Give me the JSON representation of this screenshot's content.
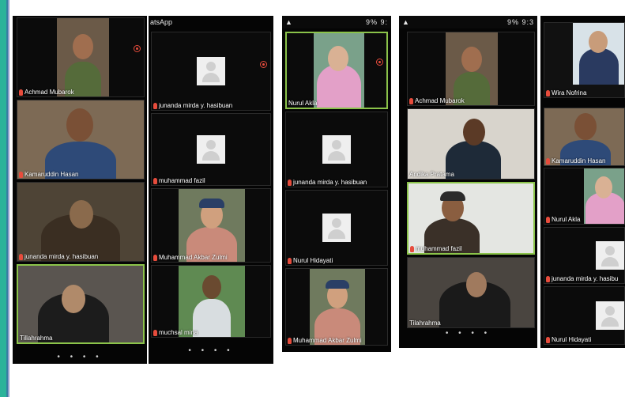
{
  "phone1": {
    "tiles": [
      {
        "name": "Achmad Mubarok"
      },
      {
        "name": "Kamaruddin Hasan"
      },
      {
        "name": "junanda mirda y. hasibuan"
      },
      {
        "name": "Tillahrahma"
      }
    ]
  },
  "phone2": {
    "app_title": "atsApp",
    "tiles": [
      {
        "name": "junanda mirda y. hasibuan"
      },
      {
        "name": "muhammad fazil"
      },
      {
        "name": "Muhammad Akbar Zulmi"
      },
      {
        "name": "muchsal mina"
      }
    ]
  },
  "phone3": {
    "status_right": "9% 9:",
    "tiles": [
      {
        "name": "Nurul Akla"
      },
      {
        "name": "junanda mirda y. hasibuan"
      },
      {
        "name": "Nurul Hidayati"
      },
      {
        "name": "Muhammad Akbar Zulmi"
      }
    ]
  },
  "phone4": {
    "status_right": "9% 9:3",
    "tiles": [
      {
        "name": "Achmad Mubarok"
      },
      {
        "name": "Andika Pratama"
      },
      {
        "name": "muhammad fazil"
      },
      {
        "name": "Tilahrahma"
      }
    ]
  },
  "phone5": {
    "tiles": [
      {
        "name": "Wira Nofrina"
      },
      {
        "name": "Kamaruddin Hasan"
      },
      {
        "name": "Nurul Akla"
      },
      {
        "name": "junanda mirda y. hasibu"
      },
      {
        "name": "Nurul Hidayati"
      }
    ]
  },
  "dots": "• • • •",
  "colors": {
    "active_border": "#8bc34a",
    "mic": "#e74c3c",
    "accent": "#2bb39a"
  }
}
